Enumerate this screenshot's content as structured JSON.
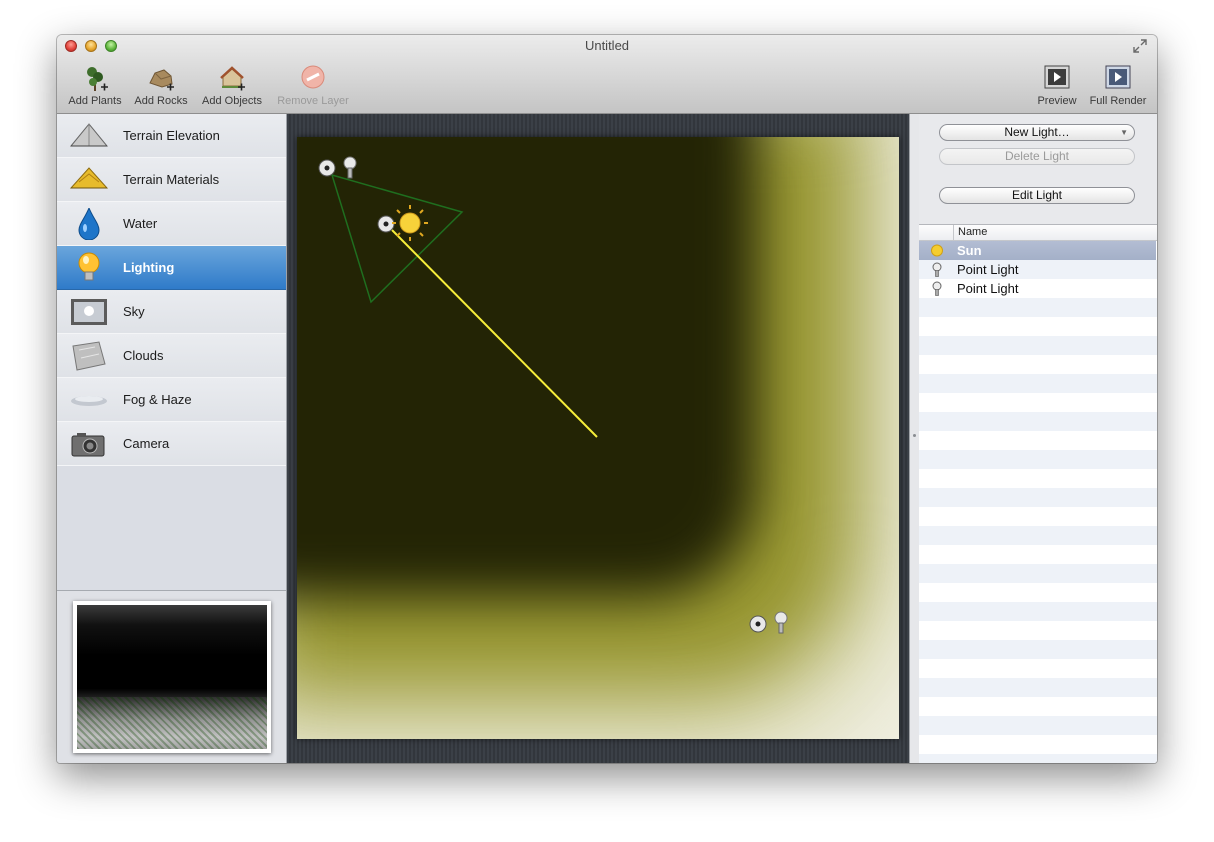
{
  "window": {
    "title": "Untitled"
  },
  "toolbar": {
    "add_plants": "Add Plants",
    "add_rocks": "Add Rocks",
    "add_objects": "Add Objects",
    "remove_layer": "Remove Layer",
    "preview": "Preview",
    "full_render": "Full Render"
  },
  "sidebar": {
    "items": [
      {
        "label": "Terrain Elevation",
        "icon": "terrain-elevation-icon"
      },
      {
        "label": "Terrain Materials",
        "icon": "terrain-materials-icon"
      },
      {
        "label": "Water",
        "icon": "water-drop-icon"
      },
      {
        "label": "Lighting",
        "icon": "lightbulb-icon",
        "selected": true
      },
      {
        "label": "Sky",
        "icon": "sky-icon"
      },
      {
        "label": "Clouds",
        "icon": "clouds-icon"
      },
      {
        "label": "Fog & Haze",
        "icon": "fog-icon"
      },
      {
        "label": "Camera",
        "icon": "camera-icon"
      }
    ]
  },
  "lights_panel": {
    "new_light": "New Light…",
    "delete_light": "Delete Light",
    "edit_light": "Edit Light",
    "column_name": "Name",
    "rows": [
      {
        "name": "Sun",
        "icon": "sun-icon",
        "selected": true
      },
      {
        "name": "Point Light",
        "icon": "point-light-icon"
      },
      {
        "name": "Point Light",
        "icon": "point-light-icon"
      }
    ]
  },
  "colors": {
    "selection_blue": "#3d85cf",
    "sun_line": "#f6ee3a",
    "light_cone": "#1f6e1f"
  }
}
